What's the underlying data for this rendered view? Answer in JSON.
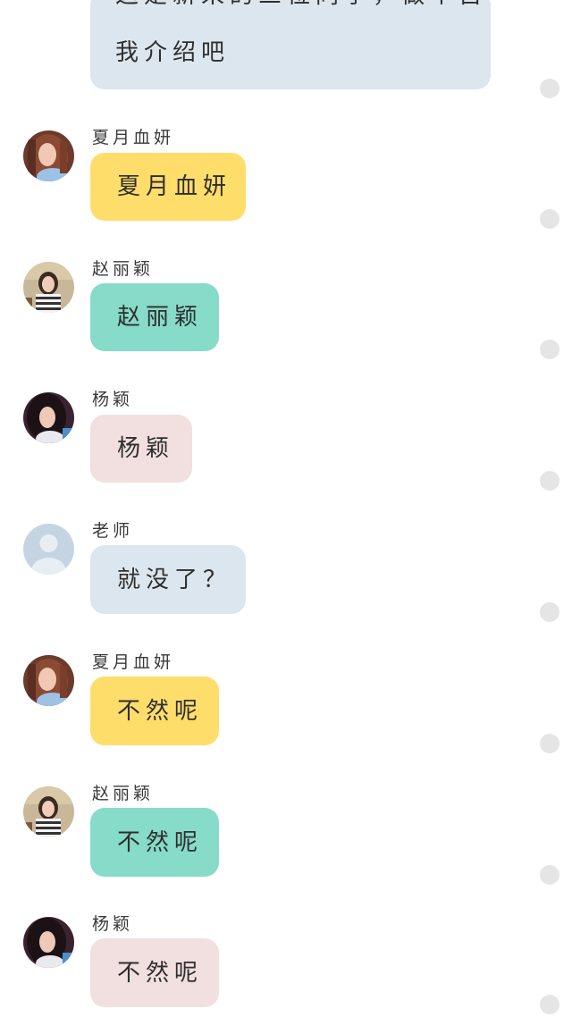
{
  "colors": {
    "yellow_bubble": "#ffdd6b",
    "teal_bubble": "#86dbc9",
    "pink_bubble": "#f2dfdf",
    "blue_bubble": "#dce6ee",
    "read_dot": "#e5e5e5"
  },
  "messages": [
    {
      "style": "blue",
      "text_line1": "这是新来的三位同学，做个自",
      "text_line2": "我介绍吧"
    },
    {
      "sender": "夏月血妍",
      "avatar": "girl-avatar-brown-hair",
      "style": "yellow",
      "text": "夏月血妍"
    },
    {
      "sender": "赵丽颖",
      "avatar": "girl-avatar-striped-shirt",
      "style": "teal",
      "text": "赵丽颖"
    },
    {
      "sender": "杨颖",
      "avatar": "girl-avatar-dark-hair",
      "style": "pink",
      "text": "杨颖"
    },
    {
      "sender": "老师",
      "avatar": "default-user-icon",
      "style": "blue",
      "text": "就没了？"
    },
    {
      "sender": "夏月血妍",
      "avatar": "girl-avatar-brown-hair",
      "style": "yellow",
      "text": "不然呢"
    },
    {
      "sender": "赵丽颖",
      "avatar": "girl-avatar-striped-shirt",
      "style": "teal",
      "text": "不然呢"
    },
    {
      "sender": "杨颖",
      "avatar": "girl-avatar-dark-hair",
      "style": "pink",
      "text": "不然呢"
    }
  ]
}
